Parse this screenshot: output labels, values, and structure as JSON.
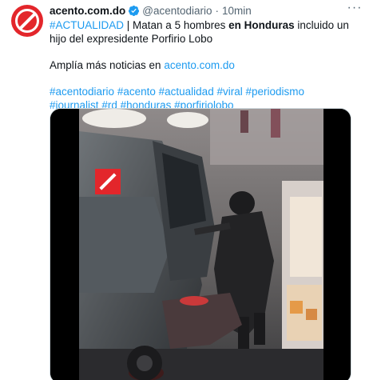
{
  "tweet": {
    "author_name": "acento.com.do",
    "handle": "@acentodiario",
    "separator": "·",
    "time": "10min",
    "more_label": "···",
    "text": {
      "hashtag_tag": "#ACTUALIDAD",
      "pipe": " | Matan a 5 hombres ",
      "prep": "en ",
      "country": "Honduras",
      "rest_line": " incluido un hijo del expresidente Porfirio Lobo",
      "more_news": "Amplía más noticias en ",
      "site_link": "acento.com.do",
      "hashtags": [
        "#acentodiario",
        "#acento",
        "#actualidad",
        "#viral",
        "#periodismo",
        "#journalist",
        "#rd",
        "#honduras",
        "#porfiriolobo"
      ]
    }
  },
  "colors": {
    "accent": "#1d9bf0",
    "brand_red": "#e3262b",
    "text": "#0f1419",
    "secondary": "#536471"
  },
  "icons": {
    "avatar": "acento-logo-icon",
    "verified": "verified-badge-icon",
    "more": "more-options-icon",
    "video_watermark": "acento-watermark-icon"
  }
}
